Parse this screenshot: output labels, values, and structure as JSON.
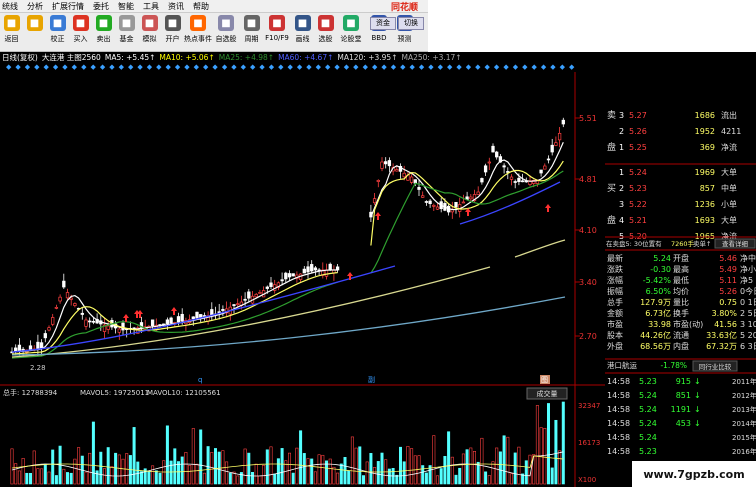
{
  "menu": [
    "统线",
    "分析",
    "扩展行情",
    "委托",
    "智能",
    "工具",
    "资讯",
    "帮助"
  ],
  "brand": "同花顺",
  "toolbar": [
    {
      "label": "返回",
      "icon": "back-icon",
      "color": "#e8a400"
    },
    {
      "label": "",
      "icon": "next-icon",
      "color": "#e8a400"
    },
    {
      "label": "校正",
      "icon": "correct-icon",
      "color": "#3a7bd5"
    },
    {
      "label": "买入",
      "icon": "buy-icon",
      "color": "#d32"
    },
    {
      "label": "卖出",
      "icon": "sell-icon",
      "color": "#2a2"
    },
    {
      "label": "基金",
      "icon": "fund-icon",
      "color": "#999"
    },
    {
      "label": "模拟",
      "icon": "simulate-icon",
      "color": "#c55"
    },
    {
      "label": "开户",
      "icon": "open-account-icon",
      "color": "#555"
    },
    {
      "label": "热点事件",
      "icon": "hot-event-icon",
      "color": "#f60"
    },
    {
      "label": "自选股",
      "icon": "watchlist-icon",
      "color": "#88a"
    },
    {
      "label": "周期",
      "icon": "period-icon",
      "color": "#666"
    },
    {
      "label": "F10/F9",
      "icon": "f10-icon",
      "color": "#c33"
    },
    {
      "label": "画线",
      "icon": "draw-line-icon",
      "color": "#358"
    },
    {
      "label": "选股",
      "icon": "select-stock-icon",
      "color": "#c33"
    },
    {
      "label": "论股堂",
      "icon": "forum-icon",
      "color": "#2a6"
    },
    {
      "label": "BBD",
      "icon": "bbd-icon",
      "color": "#35a"
    },
    {
      "label": "预测",
      "icon": "forecast-icon",
      "color": "#35a"
    }
  ],
  "toolbar_extra": {
    "fund_label": "资金",
    "switch_label": "切换"
  },
  "infobar": [
    {
      "text": "日线(复权)",
      "color": "#fff"
    },
    {
      "text": "大连港 主图2560",
      "color": "#fff"
    },
    {
      "text": "MA5: +5.45↑",
      "color": "#fff"
    },
    {
      "text": "MA10: +5.06↑",
      "color": "#ffff00"
    },
    {
      "text": "MA25: +4.98↑",
      "color": "#2f8f2f"
    },
    {
      "text": "MA60: +4.67↑",
      "color": "#4f5fff"
    },
    {
      "text": "MA120: +3.95↑",
      "color": "#ddd"
    },
    {
      "text": "MA250: +3.17↑",
      "color": "#aaa"
    }
  ],
  "diamonds": "◆◆◆◆◆◆◆◆◆◆◆◆◆◆◆◆◆◆◆◆◆◆◆◆◆◆◆◆◆◆◆◆◆◆◆◆◆◆◆◆◆◆◆◆◆◆◆◆◆◆◆◆◆◆◆◆◆◆◆◆◆",
  "chart_data": {
    "type": "line",
    "price_axis": [
      "5.51",
      "4.81",
      "4.10",
      "3.40",
      "2.70"
    ],
    "low_label": "2.28",
    "volume_label": "总手: 12788394",
    "mavol5_label": "MAVOL5: 19725011",
    "mavol10_label": "MAVOL10: 12105561",
    "volume_button": "成交量",
    "volume_axis": [
      "32347",
      "16173",
      "X100"
    ],
    "month_marks": [
      "q",
      "副",
      "图"
    ]
  },
  "order_book": {
    "sell": [
      {
        "side": "卖",
        "level": "3",
        "price": "5.27",
        "vol": "1686"
      },
      {
        "side": "",
        "level": "2",
        "price": "5.26",
        "vol": "1952"
      },
      {
        "side": "盘",
        "level": "1",
        "price": "5.25",
        "vol": "369"
      }
    ],
    "sell_right": [
      "流出",
      "4211",
      "净流"
    ],
    "buy": [
      {
        "side": "",
        "level": "1",
        "price": "5.24",
        "vol": "1969"
      },
      {
        "side": "买",
        "level": "2",
        "price": "5.23",
        "vol": "857"
      },
      {
        "side": "",
        "level": "3",
        "price": "5.22",
        "vol": "1236"
      },
      {
        "side": "盘",
        "level": "4",
        "price": "5.21",
        "vol": "1693"
      },
      {
        "side": "",
        "level": "5",
        "price": "5.20",
        "vol": "1965"
      }
    ],
    "buy_right": [
      "大单",
      "中单",
      "小单",
      "大单",
      "净流"
    ]
  },
  "status_row": {
    "a": "在卖盘5: 30位置有",
    "b": "7260手",
    "c": "卖单↑",
    "d": "查看详细"
  },
  "quote": [
    {
      "l1": "最新",
      "v1": "5.24",
      "l2": "开盘",
      "v2": "5.46",
      "r": "净中"
    },
    {
      "l1": "涨跌",
      "v1": "-0.30",
      "l2": "最高",
      "v2": "5.49",
      "r": "净小"
    },
    {
      "l1": "涨幅",
      "v1": "-5.42%",
      "l2": "最低",
      "v2": "5.11",
      "r": "净5"
    },
    {
      "l1": "振幅",
      "v1": "6.50%",
      "l2": "均价",
      "v2": "5.26",
      "r": "0今日"
    },
    {
      "l1": "总手",
      "v1": "127.9万",
      "l2": "量比",
      "v2": "0.75",
      "r": "0 1日"
    },
    {
      "l1": "金额",
      "v1": "6.73亿",
      "l2": "换手",
      "v2": "3.80%",
      "r": "2 5日"
    },
    {
      "l1": "市盈",
      "v1": "33.98",
      "l2": "市盈(动)",
      "v2": "41.56",
      "r": "3 10日"
    },
    {
      "l1": "股本",
      "v1": "44.26亿",
      "l2": "流通",
      "v2": "33.63亿",
      "r": "5 20日"
    },
    {
      "l1": "外盘",
      "v1": "68.56万",
      "l2": "内盘",
      "v2": "67.32万",
      "r": "6 3日"
    }
  ],
  "sector_row": {
    "name": "港口航运",
    "change": "-1.78%",
    "button": "同行业比较"
  },
  "ticks": [
    {
      "time": "14:58",
      "price": "5.23",
      "vol": "915",
      "arrow": "↓",
      "date": "2011年2"
    },
    {
      "time": "14:58",
      "price": "5.24",
      "vol": "851",
      "arrow": "↓",
      "date": "2012年"
    },
    {
      "time": "14:58",
      "price": "5.24",
      "vol": "1191",
      "arrow": "↓",
      "date": "2013年"
    },
    {
      "time": "14:58",
      "price": "5.24",
      "vol": "453",
      "arrow": "↓",
      "date": "2014年"
    },
    {
      "time": "14:58",
      "price": "5.24",
      "vol": "",
      "arrow": "",
      "date": "2015年"
    },
    {
      "time": "14:58",
      "price": "5.23",
      "vol": "",
      "arrow": "",
      "date": "2016年"
    }
  ],
  "watermark": "www.7gpzb.com"
}
